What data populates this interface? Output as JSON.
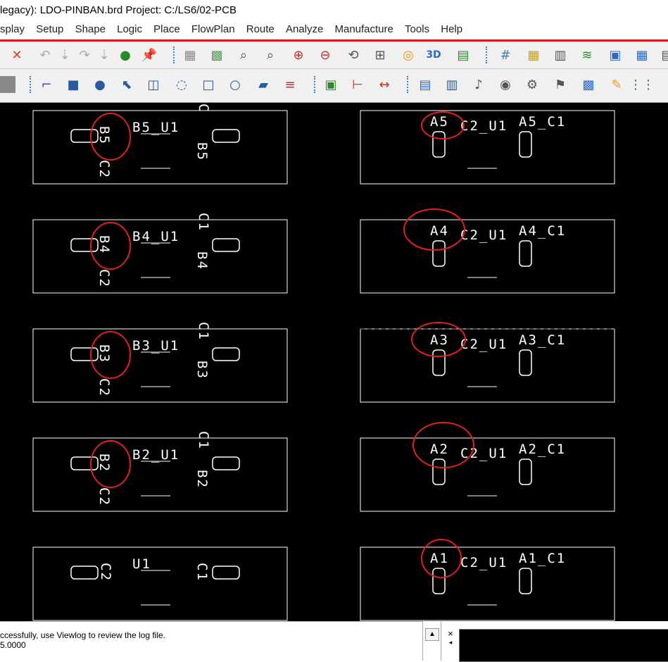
{
  "window": {
    "title": "legacy): LDO-PINBAN.brd  Project: C:/LS6/02-PCB"
  },
  "menu": [
    "splay",
    "Setup",
    "Shape",
    "Logic",
    "Place",
    "FlowPlan",
    "Route",
    "Analyze",
    "Manufacture",
    "Tools",
    "Help"
  ],
  "toolbar1_icons": [
    "delete-icon",
    "undo-icon",
    "redo-down-icon",
    "redo-icon",
    "redo-down2-icon",
    "zoom-sphere-icon",
    "pin-icon",
    "grid-icon",
    "grid2-icon",
    "zoom-window-icon",
    "zoom-fit-icon",
    "zoom-in-icon",
    "zoom-out-icon",
    "zoom-prev-icon",
    "zoom-world-icon",
    "refresh-icon",
    "3d-icon",
    "flip-icon",
    "grid-toggle-icon",
    "color-icon",
    "layers-icon",
    "shapes-icon",
    "ecm-icon",
    "dfa-icon",
    "table-icon"
  ],
  "toolbar2_icons": [
    "panel-icon",
    "line-icon",
    "rect-icon",
    "circle-icon",
    "select-icon",
    "shape-icon",
    "arc-icon",
    "square-icon",
    "circle2-icon",
    "fill-icon",
    "stack-icon",
    "component-icon",
    "dimension-icon",
    "measure-icon",
    "odb-icon",
    "book-icon",
    "prop-icon",
    "camera-icon",
    "rename-icon",
    "flag-icon",
    "chip-icon",
    "text-icon",
    "matrix-icon"
  ],
  "pcb": {
    "left_boards": [
      {
        "ref_u": "B5_U1",
        "pin_left": "B5",
        "pin_right": "B5",
        "cap_label": "C2",
        "cap_label2": "C"
      },
      {
        "ref_u": "B4_U1",
        "pin_left": "B4",
        "pin_right": "B4",
        "cap_label": "C2",
        "cap_label2": "C1"
      },
      {
        "ref_u": "B3_U1",
        "pin_left": "B3",
        "pin_right": "B3",
        "cap_label": "C2",
        "cap_label2": "C1"
      },
      {
        "ref_u": "B2_U1",
        "pin_left": "B2",
        "pin_right": "B2",
        "cap_label": "C2",
        "cap_label2": "C1"
      },
      {
        "ref_u": "U1",
        "pin_left": "C2",
        "pin_right": "C1",
        "cap_label": "",
        "cap_label2": ""
      }
    ],
    "right_boards": [
      {
        "prefix": "A5",
        "mid": "C2_U1",
        "cap": "A5_C1"
      },
      {
        "prefix": "A4",
        "mid": "C2_U1",
        "cap": "A4_C1"
      },
      {
        "prefix": "A3",
        "mid": "C2_U1",
        "cap": "A3_C1"
      },
      {
        "prefix": "A2",
        "mid": "C2_U1",
        "cap": "A2_C1"
      },
      {
        "prefix": "A1",
        "mid": "C2_U1",
        "cap": "A1_C1"
      }
    ],
    "highlight_color": "#e02020",
    "outline_color": "#ffffff"
  },
  "console": {
    "line1": "ccessfully, use Viewlog to review the log file.",
    "line2": "5.0000"
  },
  "side_close": "×"
}
